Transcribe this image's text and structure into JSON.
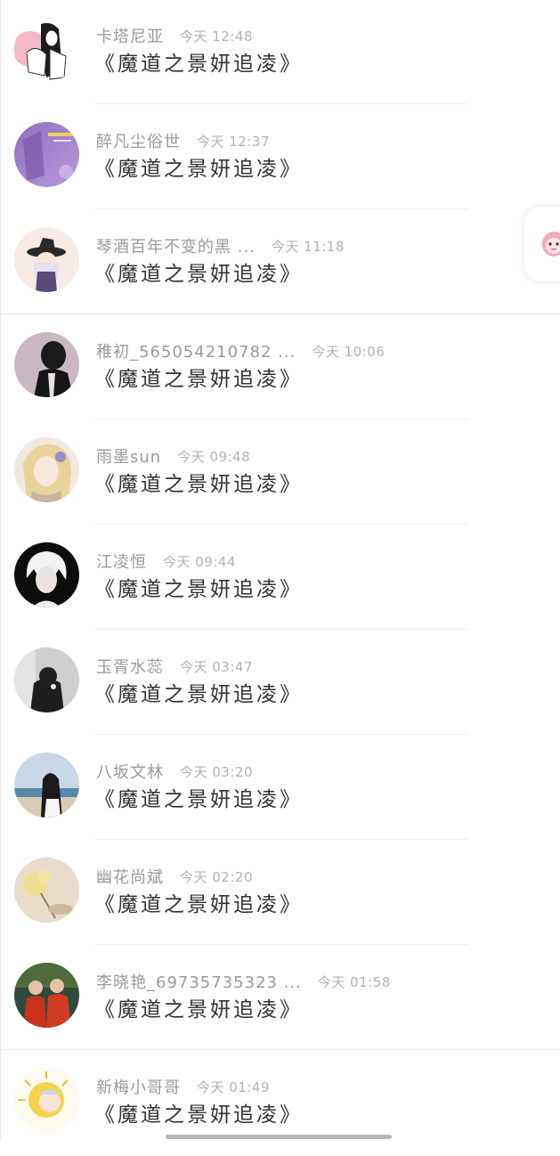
{
  "messages": [
    {
      "name": "卡塔尼亚",
      "time": "今天 12:48",
      "content": "《魔道之景妍追凌》",
      "avatar": "anime-sketch-avatar"
    },
    {
      "name": "醉凡尘俗世",
      "time": "今天 12:37",
      "content": "《魔道之景妍追凌》",
      "avatar": "purple-poster-avatar"
    },
    {
      "name": "琴酒百年不变的黑 ...",
      "time": "今天 11:18",
      "content": "《魔道之景妍追凌》",
      "avatar": "anime-witch-avatar"
    },
    {
      "name": "稚初_565054210782 ...",
      "time": "今天 10:06",
      "content": "《魔道之景妍追凌》",
      "avatar": "dark-portrait-avatar"
    },
    {
      "name": "雨墨sun",
      "time": "今天 09:48",
      "content": "《魔道之景妍追凌》",
      "avatar": "blonde-anime-avatar"
    },
    {
      "name": "江凌恒",
      "time": "今天 09:44",
      "content": "《魔道之景妍追凌》",
      "avatar": "white-hair-anime-avatar"
    },
    {
      "name": "玉胥水蕊",
      "time": "今天 03:47",
      "content": "《魔道之景妍追凌》",
      "avatar": "gray-figure-avatar"
    },
    {
      "name": "八坂文林",
      "time": "今天 03:20",
      "content": "《魔道之景妍追凌》",
      "avatar": "beach-girl-avatar"
    },
    {
      "name": "幽花尚斌",
      "time": "今天 02:20",
      "content": "《魔道之景妍追凌》",
      "avatar": "flower-avatar"
    },
    {
      "name": "李晓艳_69735735323 ...",
      "time": "今天 01:58",
      "content": "《魔道之景妍追凌》",
      "avatar": "couple-red-avatar"
    },
    {
      "name": "新梅小哥哥",
      "time": "今天 01:49",
      "content": "《魔道之景妍追凌》",
      "avatar": "sun-baby-avatar"
    }
  ],
  "floating_button": {
    "icon": "pink-mascot-icon"
  },
  "colors": {
    "name_text": "#9a9a9a",
    "time_text": "#b2b2b2",
    "content_text": "#333333",
    "divider": "#f0f0f0",
    "background": "#ffffff"
  }
}
